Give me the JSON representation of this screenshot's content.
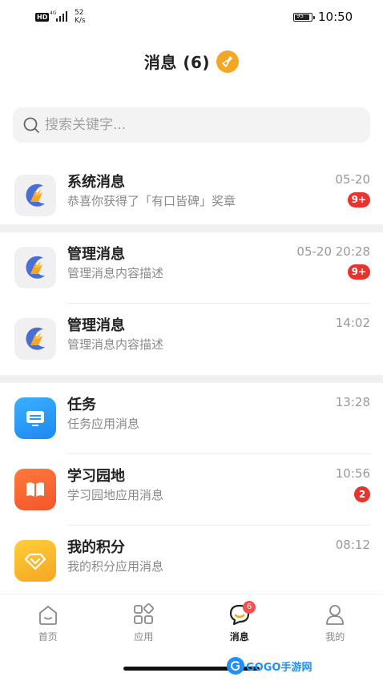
{
  "status_bar": {
    "hd": "HD",
    "network": "4G",
    "speed_value": "52",
    "speed_unit": "K/s",
    "battery": "95",
    "time": "10:50"
  },
  "header": {
    "title": "消息 (6)",
    "clear_icon": "broom-icon"
  },
  "search": {
    "placeholder": "搜索关键字..."
  },
  "groups": [
    {
      "items": [
        {
          "icon": "system-logo-icon",
          "title": "系统消息",
          "subtitle": "恭喜你获得了「有口皆碑」奖章",
          "time": "05-20",
          "badge": "9+"
        }
      ]
    },
    {
      "items": [
        {
          "icon": "system-logo-icon",
          "title": "管理消息",
          "subtitle": "管理消息内容描述",
          "time": "05-20 20:28",
          "badge": "9+"
        },
        {
          "icon": "system-logo-icon",
          "title": "管理消息",
          "subtitle": "管理消息内容描述",
          "time": "14:02",
          "badge": ""
        }
      ]
    },
    {
      "items": [
        {
          "icon": "task-monitor-icon",
          "title": "任务",
          "subtitle": "任务应用消息",
          "time": "13:28",
          "badge": ""
        },
        {
          "icon": "book-icon",
          "title": "学习园地",
          "subtitle": "学习园地应用消息",
          "time": "10:56",
          "badge": "2"
        },
        {
          "icon": "diamond-icon",
          "title": "我的积分",
          "subtitle": "我的积分应用消息",
          "time": "08:12",
          "badge": ""
        }
      ]
    }
  ],
  "tabbar": {
    "tabs": [
      {
        "label": "首页",
        "icon": "home-icon",
        "active": false
      },
      {
        "label": "应用",
        "icon": "apps-grid-icon",
        "active": false
      },
      {
        "label": "消息",
        "icon": "message-bubble-icon",
        "active": true,
        "badge": "6"
      },
      {
        "label": "我的",
        "icon": "profile-icon",
        "active": false
      }
    ]
  },
  "watermark": {
    "text": "GOGO手游网"
  },
  "colors": {
    "accent": "#f5a623",
    "badge": "#e8332f",
    "separator": "#f0f0f0"
  }
}
